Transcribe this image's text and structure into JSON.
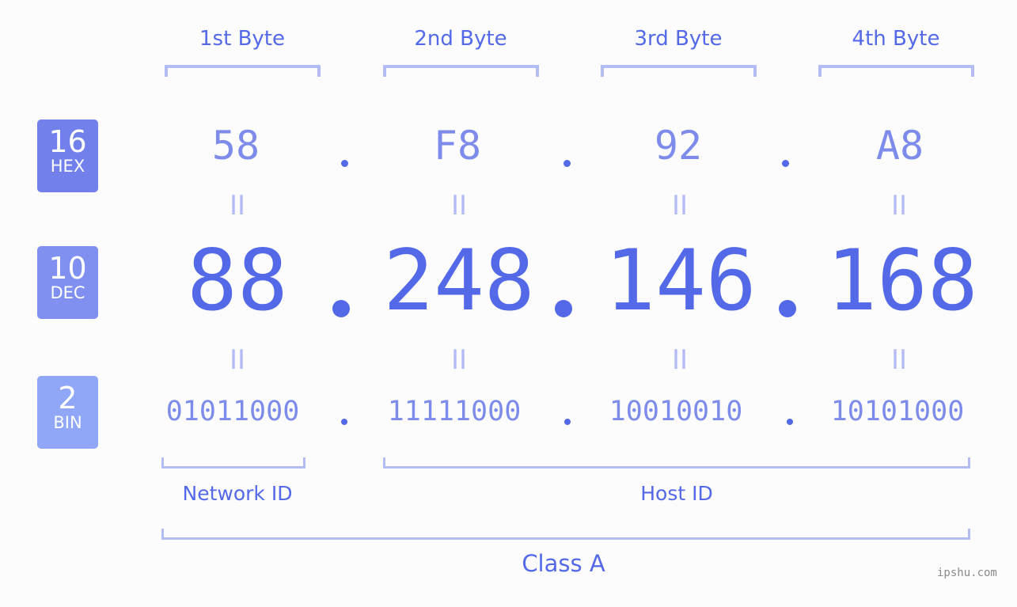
{
  "colors": {
    "accent": "#5469e8",
    "hex_badge": "#7280ec",
    "dec_badge": "#8090f0",
    "bin_badge": "#90a6f6",
    "light_value": "#7d8ceb",
    "bracket": "#b3bcf5",
    "background": "#fbfcfb"
  },
  "badges": [
    {
      "number": "16",
      "label": "HEX"
    },
    {
      "number": "10",
      "label": "DEC"
    },
    {
      "number": "2",
      "label": "BIN"
    }
  ],
  "bytes": [
    {
      "header": "1st Byte",
      "hex": "58",
      "dec": "88",
      "bin": "01011000"
    },
    {
      "header": "2nd Byte",
      "hex": "F8",
      "dec": "248",
      "bin": "11111000"
    },
    {
      "header": "3rd Byte",
      "hex": "92",
      "dec": "146",
      "bin": "10010010"
    },
    {
      "header": "4th Byte",
      "hex": "A8",
      "dec": "168",
      "bin": "10101000"
    }
  ],
  "equals_glyph": "II",
  "network_id_label": "Network ID",
  "host_id_label": "Host ID",
  "class_label": "Class A",
  "watermark": "ipshu.com"
}
